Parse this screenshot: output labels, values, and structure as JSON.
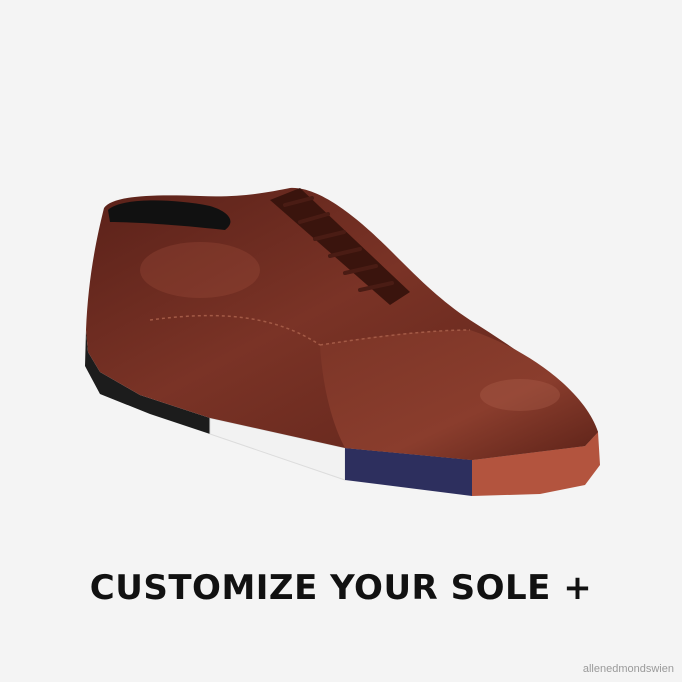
{
  "product_image": {
    "icon": "shoe-illustration",
    "colors": {
      "background": "#f4f4f4",
      "leather": "#6a2a1f",
      "sole_black": "#1c1c1c",
      "sole_white": "#f2f2f2",
      "sole_navy": "#2d2f5e",
      "sole_rust": "#b3543e"
    }
  },
  "cta": {
    "label": "CUSTOMIZE YOUR SOLE +"
  },
  "watermark": {
    "text": "allenedmondswien"
  }
}
